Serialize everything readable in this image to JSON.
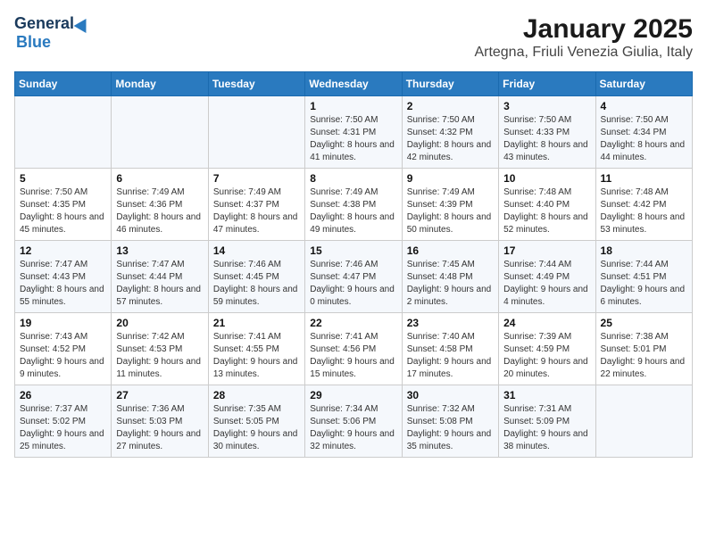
{
  "logo": {
    "general": "General",
    "blue": "Blue"
  },
  "title": "January 2025",
  "subtitle": "Artegna, Friuli Venezia Giulia, Italy",
  "days_of_week": [
    "Sunday",
    "Monday",
    "Tuesday",
    "Wednesday",
    "Thursday",
    "Friday",
    "Saturday"
  ],
  "weeks": [
    [
      {
        "day": "",
        "info": ""
      },
      {
        "day": "",
        "info": ""
      },
      {
        "day": "",
        "info": ""
      },
      {
        "day": "1",
        "info": "Sunrise: 7:50 AM\nSunset: 4:31 PM\nDaylight: 8 hours and 41 minutes."
      },
      {
        "day": "2",
        "info": "Sunrise: 7:50 AM\nSunset: 4:32 PM\nDaylight: 8 hours and 42 minutes."
      },
      {
        "day": "3",
        "info": "Sunrise: 7:50 AM\nSunset: 4:33 PM\nDaylight: 8 hours and 43 minutes."
      },
      {
        "day": "4",
        "info": "Sunrise: 7:50 AM\nSunset: 4:34 PM\nDaylight: 8 hours and 44 minutes."
      }
    ],
    [
      {
        "day": "5",
        "info": "Sunrise: 7:50 AM\nSunset: 4:35 PM\nDaylight: 8 hours and 45 minutes."
      },
      {
        "day": "6",
        "info": "Sunrise: 7:49 AM\nSunset: 4:36 PM\nDaylight: 8 hours and 46 minutes."
      },
      {
        "day": "7",
        "info": "Sunrise: 7:49 AM\nSunset: 4:37 PM\nDaylight: 8 hours and 47 minutes."
      },
      {
        "day": "8",
        "info": "Sunrise: 7:49 AM\nSunset: 4:38 PM\nDaylight: 8 hours and 49 minutes."
      },
      {
        "day": "9",
        "info": "Sunrise: 7:49 AM\nSunset: 4:39 PM\nDaylight: 8 hours and 50 minutes."
      },
      {
        "day": "10",
        "info": "Sunrise: 7:48 AM\nSunset: 4:40 PM\nDaylight: 8 hours and 52 minutes."
      },
      {
        "day": "11",
        "info": "Sunrise: 7:48 AM\nSunset: 4:42 PM\nDaylight: 8 hours and 53 minutes."
      }
    ],
    [
      {
        "day": "12",
        "info": "Sunrise: 7:47 AM\nSunset: 4:43 PM\nDaylight: 8 hours and 55 minutes."
      },
      {
        "day": "13",
        "info": "Sunrise: 7:47 AM\nSunset: 4:44 PM\nDaylight: 8 hours and 57 minutes."
      },
      {
        "day": "14",
        "info": "Sunrise: 7:46 AM\nSunset: 4:45 PM\nDaylight: 8 hours and 59 minutes."
      },
      {
        "day": "15",
        "info": "Sunrise: 7:46 AM\nSunset: 4:47 PM\nDaylight: 9 hours and 0 minutes."
      },
      {
        "day": "16",
        "info": "Sunrise: 7:45 AM\nSunset: 4:48 PM\nDaylight: 9 hours and 2 minutes."
      },
      {
        "day": "17",
        "info": "Sunrise: 7:44 AM\nSunset: 4:49 PM\nDaylight: 9 hours and 4 minutes."
      },
      {
        "day": "18",
        "info": "Sunrise: 7:44 AM\nSunset: 4:51 PM\nDaylight: 9 hours and 6 minutes."
      }
    ],
    [
      {
        "day": "19",
        "info": "Sunrise: 7:43 AM\nSunset: 4:52 PM\nDaylight: 9 hours and 9 minutes."
      },
      {
        "day": "20",
        "info": "Sunrise: 7:42 AM\nSunset: 4:53 PM\nDaylight: 9 hours and 11 minutes."
      },
      {
        "day": "21",
        "info": "Sunrise: 7:41 AM\nSunset: 4:55 PM\nDaylight: 9 hours and 13 minutes."
      },
      {
        "day": "22",
        "info": "Sunrise: 7:41 AM\nSunset: 4:56 PM\nDaylight: 9 hours and 15 minutes."
      },
      {
        "day": "23",
        "info": "Sunrise: 7:40 AM\nSunset: 4:58 PM\nDaylight: 9 hours and 17 minutes."
      },
      {
        "day": "24",
        "info": "Sunrise: 7:39 AM\nSunset: 4:59 PM\nDaylight: 9 hours and 20 minutes."
      },
      {
        "day": "25",
        "info": "Sunrise: 7:38 AM\nSunset: 5:01 PM\nDaylight: 9 hours and 22 minutes."
      }
    ],
    [
      {
        "day": "26",
        "info": "Sunrise: 7:37 AM\nSunset: 5:02 PM\nDaylight: 9 hours and 25 minutes."
      },
      {
        "day": "27",
        "info": "Sunrise: 7:36 AM\nSunset: 5:03 PM\nDaylight: 9 hours and 27 minutes."
      },
      {
        "day": "28",
        "info": "Sunrise: 7:35 AM\nSunset: 5:05 PM\nDaylight: 9 hours and 30 minutes."
      },
      {
        "day": "29",
        "info": "Sunrise: 7:34 AM\nSunset: 5:06 PM\nDaylight: 9 hours and 32 minutes."
      },
      {
        "day": "30",
        "info": "Sunrise: 7:32 AM\nSunset: 5:08 PM\nDaylight: 9 hours and 35 minutes."
      },
      {
        "day": "31",
        "info": "Sunrise: 7:31 AM\nSunset: 5:09 PM\nDaylight: 9 hours and 38 minutes."
      },
      {
        "day": "",
        "info": ""
      }
    ]
  ]
}
